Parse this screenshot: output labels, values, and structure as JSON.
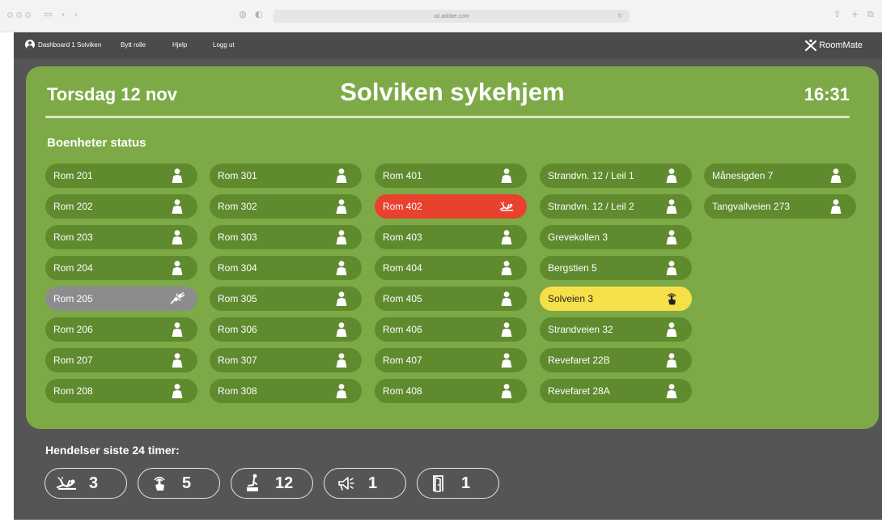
{
  "browser": {
    "url": "xd.adobe.com"
  },
  "nav": {
    "user_label": "Dashboard 1 Solviken",
    "switch_role": "Bytt rolle",
    "help": "Hjelp",
    "logout": "Logg ut",
    "brand": "RoomMate"
  },
  "header": {
    "date": "Torsdag 12 nov",
    "title": "Solviken sykehjem",
    "time": "16:31"
  },
  "units": {
    "heading": "Boenheter status",
    "columns": [
      [
        {
          "label": "Rom 201",
          "status": "ok",
          "icon": "person-icon"
        },
        {
          "label": "Rom 202",
          "status": "ok",
          "icon": "person-icon"
        },
        {
          "label": "Rom 203",
          "status": "ok",
          "icon": "person-icon"
        },
        {
          "label": "Rom 204",
          "status": "ok",
          "icon": "person-icon"
        },
        {
          "label": "Rom 205",
          "status": "offline",
          "icon": "disconnected-plug-icon"
        },
        {
          "label": "Rom 206",
          "status": "ok",
          "icon": "person-icon"
        },
        {
          "label": "Rom 207",
          "status": "ok",
          "icon": "person-icon"
        },
        {
          "label": "Rom 208",
          "status": "ok",
          "icon": "person-icon"
        }
      ],
      [
        {
          "label": "Rom 301",
          "status": "ok",
          "icon": "person-icon"
        },
        {
          "label": "Rom 302",
          "status": "ok",
          "icon": "person-icon"
        },
        {
          "label": "Rom 303",
          "status": "ok",
          "icon": "person-icon"
        },
        {
          "label": "Rom 304",
          "status": "ok",
          "icon": "person-icon"
        },
        {
          "label": "Rom 305",
          "status": "ok",
          "icon": "person-icon"
        },
        {
          "label": "Rom 306",
          "status": "ok",
          "icon": "person-icon"
        },
        {
          "label": "Rom 307",
          "status": "ok",
          "icon": "person-icon"
        },
        {
          "label": "Rom 308",
          "status": "ok",
          "icon": "person-icon"
        }
      ],
      [
        {
          "label": "Rom 401",
          "status": "ok",
          "icon": "person-icon"
        },
        {
          "label": "Rom 402",
          "status": "alarm",
          "icon": "fall-icon"
        },
        {
          "label": "Rom 403",
          "status": "ok",
          "icon": "person-icon"
        },
        {
          "label": "Rom 404",
          "status": "ok",
          "icon": "person-icon"
        },
        {
          "label": "Rom 405",
          "status": "ok",
          "icon": "person-icon"
        },
        {
          "label": "Rom 406",
          "status": "ok",
          "icon": "person-icon"
        },
        {
          "label": "Rom 407",
          "status": "ok",
          "icon": "person-icon"
        },
        {
          "label": "Rom 408",
          "status": "ok",
          "icon": "person-icon"
        }
      ],
      [
        {
          "label": "Strandvn. 12 / Leil 1",
          "status": "ok",
          "icon": "person-icon"
        },
        {
          "label": "Strandvn. 12 / Leil 2",
          "status": "ok",
          "icon": "person-icon"
        },
        {
          "label": "Grevekollen 3",
          "status": "ok",
          "icon": "person-icon"
        },
        {
          "label": "Bergstien 5",
          "status": "ok",
          "icon": "person-icon"
        },
        {
          "label": "Solveien 3",
          "status": "call",
          "icon": "call-button-icon"
        },
        {
          "label": "Strandveien 32",
          "status": "ok",
          "icon": "person-icon"
        },
        {
          "label": "Revefaret 22B",
          "status": "ok",
          "icon": "person-icon"
        },
        {
          "label": "Revefaret 28A",
          "status": "ok",
          "icon": "person-icon"
        }
      ],
      [
        {
          "label": "Månesigden 7",
          "status": "ok",
          "icon": "person-icon"
        },
        {
          "label": "Tangvallveien 273",
          "status": "ok",
          "icon": "person-icon"
        }
      ]
    ]
  },
  "events": {
    "heading": "Hendelser siste 24 timer:",
    "items": [
      {
        "icon": "fall-icon",
        "count": "3"
      },
      {
        "icon": "call-button-icon",
        "count": "5"
      },
      {
        "icon": "bed-exit-icon",
        "count": "12"
      },
      {
        "icon": "alarm-horn-icon",
        "count": "1"
      },
      {
        "icon": "door-icon",
        "count": "1"
      }
    ]
  },
  "colors": {
    "panel": "#7daa46",
    "unit_ok": "#5f8a2e",
    "unit_alarm": "#e8412e",
    "unit_offline": "#8c8c8c",
    "unit_call": "#f6e04a",
    "background": "#555555"
  }
}
